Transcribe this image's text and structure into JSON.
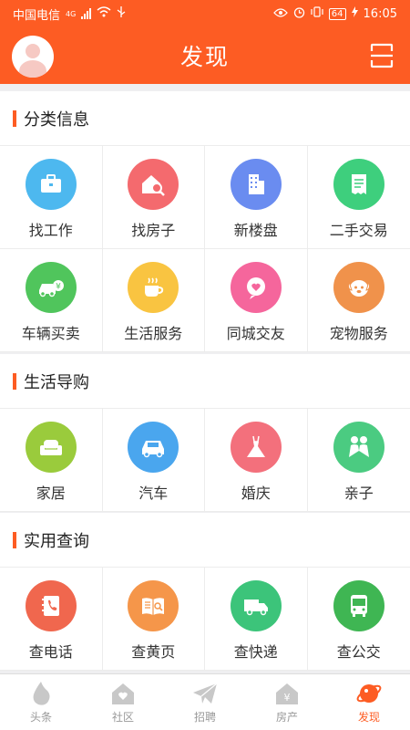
{
  "status_bar": {
    "carrier": "中国电信",
    "network": "4G",
    "battery": "64",
    "time": "16:05"
  },
  "header": {
    "title": "发现"
  },
  "sections": [
    {
      "title": "分类信息",
      "items": [
        {
          "label": "找工作",
          "icon": "briefcase-icon",
          "color": "#4db8ef"
        },
        {
          "label": "找房子",
          "icon": "house-search-icon",
          "color": "#f46a6e"
        },
        {
          "label": "新楼盘",
          "icon": "building-icon",
          "color": "#6a8cf0"
        },
        {
          "label": "二手交易",
          "icon": "receipt-icon",
          "color": "#3ecf7d"
        },
        {
          "label": "车辆买卖",
          "icon": "car-yen-icon",
          "color": "#50c55c"
        },
        {
          "label": "生活服务",
          "icon": "coffee-cup-icon",
          "color": "#f9c441"
        },
        {
          "label": "同城交友",
          "icon": "heart-chat-icon",
          "color": "#f5669c"
        },
        {
          "label": "宠物服务",
          "icon": "dog-icon",
          "color": "#f0924b"
        }
      ]
    },
    {
      "title": "生活导购",
      "items": [
        {
          "label": "家居",
          "icon": "sofa-icon",
          "color": "#9acb3c"
        },
        {
          "label": "汽车",
          "icon": "car-icon",
          "color": "#4aa6ee"
        },
        {
          "label": "婚庆",
          "icon": "dress-icon",
          "color": "#f3707c"
        },
        {
          "label": "亲子",
          "icon": "parent-child-icon",
          "color": "#4bcb81"
        }
      ]
    },
    {
      "title": "实用查询",
      "items": [
        {
          "label": "查电话",
          "icon": "phone-book-icon",
          "color": "#f0674e"
        },
        {
          "label": "查黄页",
          "icon": "yellow-pages-icon",
          "color": "#f5964a"
        },
        {
          "label": "查快递",
          "icon": "truck-icon",
          "color": "#3cc47a"
        },
        {
          "label": "查公交",
          "icon": "bus-icon",
          "color": "#3fb653"
        }
      ]
    }
  ],
  "tabs": [
    {
      "label": "头条",
      "icon": "flame-icon",
      "active": false
    },
    {
      "label": "社区",
      "icon": "community-house-icon",
      "active": false
    },
    {
      "label": "招聘",
      "icon": "paper-plane-icon",
      "active": false
    },
    {
      "label": "房产",
      "icon": "property-house-icon",
      "active": false
    },
    {
      "label": "发现",
      "icon": "planet-icon",
      "active": true
    }
  ],
  "colors": {
    "brand": "#fd5c23",
    "tab_inactive": "#c8c8c8"
  }
}
